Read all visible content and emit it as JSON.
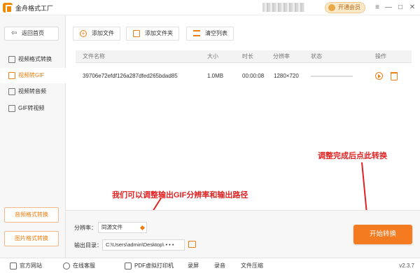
{
  "app": {
    "title": "金舟格式工厂",
    "vip_label": "开通会员",
    "version": "v2.3.7"
  },
  "window_controls": {
    "menu": "≡",
    "minimize": "—",
    "maximize": "□",
    "close": "✕"
  },
  "sidebar": {
    "back_label": "返回首页",
    "items": [
      {
        "label": "视频格式转换",
        "active": false
      },
      {
        "label": "视频转GIF",
        "active": true
      },
      {
        "label": "视频转音频",
        "active": false
      },
      {
        "label": "GIF转视频",
        "active": false
      }
    ],
    "bottom_buttons": [
      "音频格式转换",
      "图片格式转换"
    ]
  },
  "toolbar": {
    "add_file": "添加文件",
    "add_folder": "添加文件夹",
    "clear_list": "清空列表"
  },
  "table": {
    "columns": [
      "文件名称",
      "大小",
      "时长",
      "分辨率",
      "状态",
      "操作"
    ],
    "rows": [
      {
        "name": "39706e72efdf126a287dfed265bdad85",
        "size": "1.0MB",
        "duration": "00:00:08",
        "resolution": "1280×720",
        "progress": 0
      }
    ]
  },
  "annotations": {
    "convert_hint": "调整完成后点此转换",
    "settings_hint": "我们可以调整输出GIF分辨率和输出路径"
  },
  "settings": {
    "resolution_label": "分辨率：",
    "resolution_value": "同源文件",
    "output_label": "输出目录：",
    "output_path": "C:\\Users\\admin\\Desktop\\",
    "output_more": "• • •"
  },
  "convert_button": "开始转换",
  "statusbar": {
    "items": [
      "官方网站",
      "在线客服",
      "PDF虚拟打印机",
      "录屏",
      "录音",
      "文件压缩"
    ]
  },
  "colors": {
    "accent": "#ef7e12",
    "annotation": "#e02222"
  }
}
